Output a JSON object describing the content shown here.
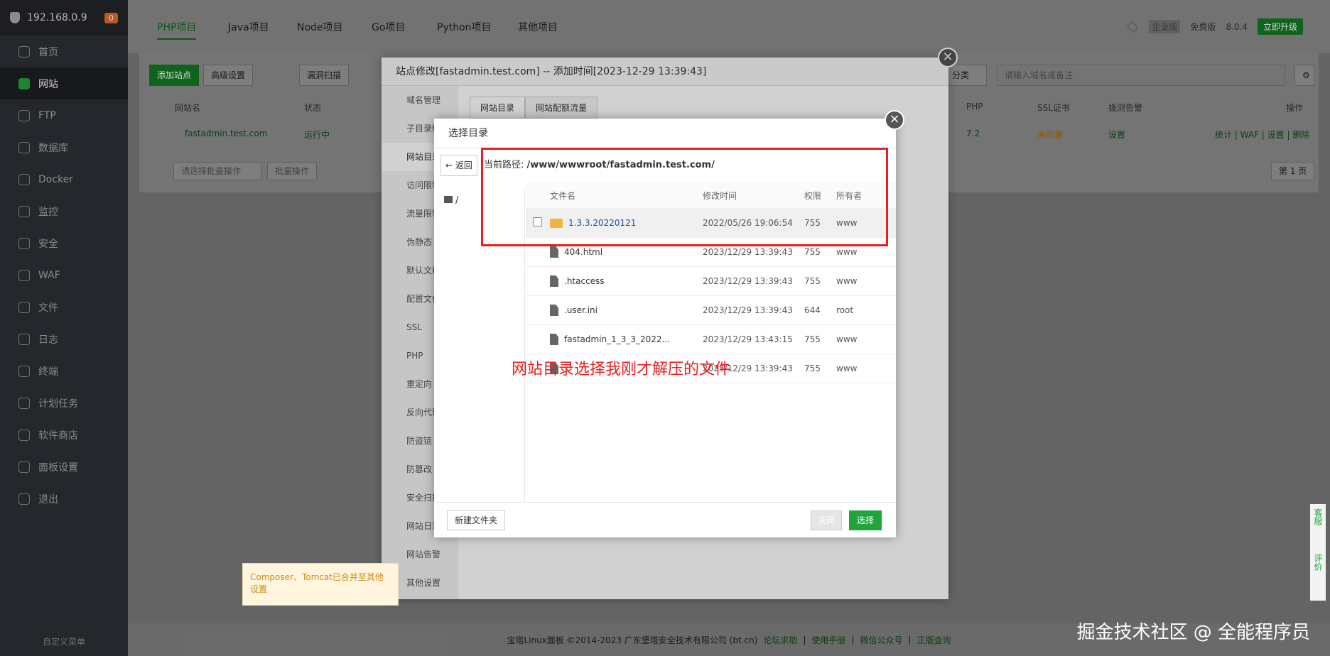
{
  "sidebar": {
    "ip": "192.168.0.9",
    "badge": "0",
    "items": [
      "首页",
      "网站",
      "FTP",
      "数据库",
      "Docker",
      "监控",
      "安全",
      "WAF",
      "文件",
      "日志",
      "终端",
      "计划任务",
      "软件商店",
      "面板设置",
      "退出"
    ],
    "bottom": "自定义菜单"
  },
  "tabs": [
    "PHP项目",
    "Java项目",
    "Node项目",
    "Go项目",
    "Python项目",
    "其他项目"
  ],
  "topright": {
    "edition": "企业版",
    "free": "免费版",
    "version": "8.0.4",
    "upgrade": "立即升级"
  },
  "bg": {
    "add": "添加站点",
    "adv": "高级设置",
    "scan": "漏洞扫描",
    "search_placeholder": "请输入域名或备注",
    "site": "fastadmin.test.com",
    "status": "运行中",
    "php": "7.2",
    "ssl": "未部署",
    "alarm": "设置",
    "ops": "统计 | WAF | 设置 | 删除",
    "batch_placeholder": "请选择批量操作",
    "batch_btn": "批量操作",
    "page": "第 1 页",
    "col_name": "网站名",
    "col_status": "状态",
    "col_php": "PHP",
    "col_ssl": "SSL证书",
    "col_alarm": "拨测告警",
    "col_ops": "操作",
    "sort_label": "分类"
  },
  "site_modal": {
    "title": "站点修改[fastadmin.test.com] -- 添加时间[2023-12-29 13:39:43]",
    "nav": [
      "域名管理",
      "子目录绑定",
      "网站目录",
      "访问限制",
      "流量限制",
      "伪静态",
      "默认文档",
      "配置文件",
      "SSL",
      "PHP",
      "重定向",
      "反向代理",
      "防盗链",
      "防篡改",
      "安全扫描",
      "网站日志",
      "网站告警",
      "其他设置"
    ],
    "tabs": [
      "网站目录",
      "网站配额流量"
    ]
  },
  "dir_modal": {
    "title": "选择目录",
    "back": "返回",
    "path_label": "当前路径:",
    "path": "/www/wwwroot/fastadmin.test.com/",
    "tree_root": "/",
    "headers": [
      "文件名",
      "修改时间",
      "权限",
      "所有者"
    ],
    "rows": [
      [
        "1.3.3.20220121",
        "2022/05/26 19:06:54",
        "755",
        "www"
      ],
      [
        "404.html",
        "2023/12/29 13:39:43",
        "755",
        "www"
      ],
      [
        ".htaccess",
        "2023/12/29 13:39:43",
        "755",
        "www"
      ],
      [
        ".user.ini",
        "2023/12/29 13:39:43",
        "644",
        "root"
      ],
      [
        "fastadmin_1_3_3_2022...",
        "2023/12/29 13:43:15",
        "755",
        "www"
      ],
      [
        "",
        "2023/12/29 13:39:43",
        "755",
        "www"
      ]
    ],
    "newdir": "新建文件夹",
    "close": "关闭",
    "select": "选择"
  },
  "annotation": "网站目录选择我刚才解压的文件",
  "tip": "Composer、Tomcat已合并至其他设置",
  "side_right": [
    "客服",
    "评价"
  ],
  "footer": {
    "copy": "宝塔Linux面板 ©2014-2023 广东堡塔安全技术有限公司 (bt.cn)",
    "links": [
      "论坛求助",
      "使用手册",
      "微信公众号",
      "正版查询"
    ]
  },
  "watermark": "掘金技术社区 @ 全能程序员"
}
